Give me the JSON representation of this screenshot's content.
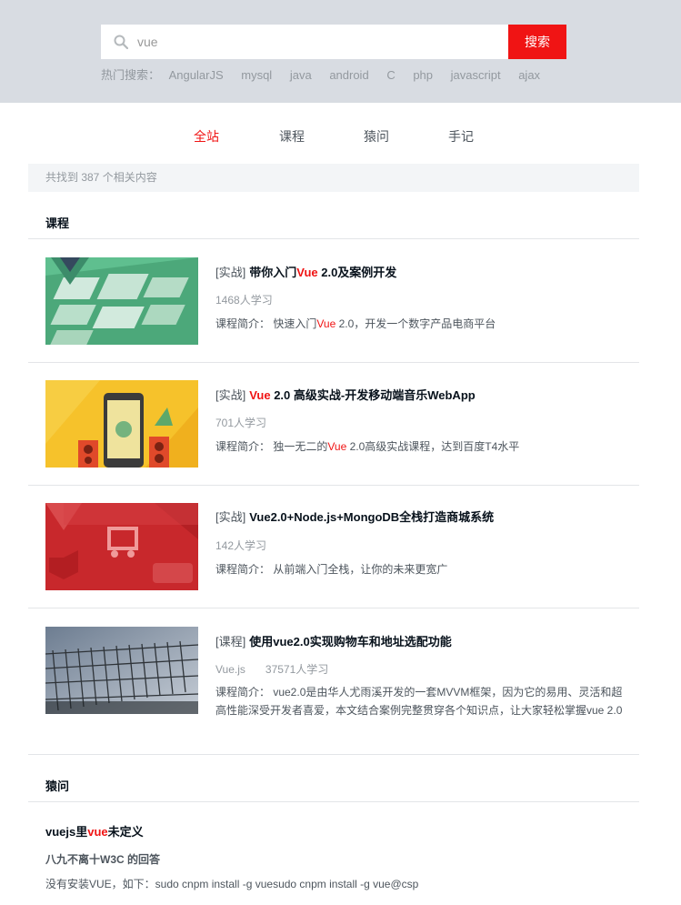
{
  "search": {
    "value": "vue",
    "button_label": "搜索",
    "hot_label": "热门搜索：",
    "hot_terms": [
      "AngularJS",
      "mysql",
      "java",
      "android",
      "C",
      "php",
      "javascript",
      "ajax"
    ]
  },
  "tabs": [
    {
      "label": "全站",
      "active": true
    },
    {
      "label": "课程",
      "active": false
    },
    {
      "label": "猿问",
      "active": false
    },
    {
      "label": "手记",
      "active": false
    }
  ],
  "result_summary": "共找到 387 个相关内容",
  "courses_section": {
    "title": "课程",
    "items": [
      {
        "tag": "[实战]",
        "title_pre": "带你入门",
        "title_hl": "Vue",
        "title_post": " 2.0及案例开发",
        "author": "",
        "learners": "1468人学习",
        "desc_pre": "课程简介： 快速入门",
        "desc_hl": "Vue",
        "desc_post": " 2.0，开发一个数字产品电商平台"
      },
      {
        "tag": "[实战]",
        "title_pre": "",
        "title_hl": "Vue",
        "title_post": " 2.0 高级实战-开发移动端音乐WebApp",
        "author": "",
        "learners": "701人学习",
        "desc_pre": "课程简介： 独一无二的",
        "desc_hl": "Vue",
        "desc_post": " 2.0高级实战课程，达到百度T4水平"
      },
      {
        "tag": "[实战]",
        "title_pre": "Vue2.0+Node.js+MongoDB全栈打造商城系统",
        "title_hl": "",
        "title_post": "",
        "author": "",
        "learners": "142人学习",
        "desc_pre": "课程简介： 从前端入门全栈，让你的未来更宽广",
        "desc_hl": "",
        "desc_post": ""
      },
      {
        "tag": "[课程]",
        "title_pre": "使用vue2.0实现购物车和地址选配功能",
        "title_hl": "",
        "title_post": "",
        "author": "Vue.js",
        "learners": "37571人学习",
        "desc_pre": "课程简介： vue2.0是由华人尤雨溪开发的一套MVVM框架，因为它的易用、灵活和超高性能深受开发者喜爱，本文结合案例完整贯穿各个知识点，让大家轻松掌握vue 2.0",
        "desc_hl": "",
        "desc_post": ""
      }
    ]
  },
  "qa_section": {
    "title": "猿问",
    "question_pre": "vuejs里",
    "question_hl": "vue",
    "question_post": "未定义",
    "answerer": "八九不离十W3C 的回答",
    "answer": "没有安装VUE，如下：sudo cnpm install -g vuesudo cnpm install -g vue@csp"
  },
  "colors": {
    "accent": "#f01414",
    "header_bg": "#d8dce2",
    "summary_bg": "#f3f5f7"
  }
}
